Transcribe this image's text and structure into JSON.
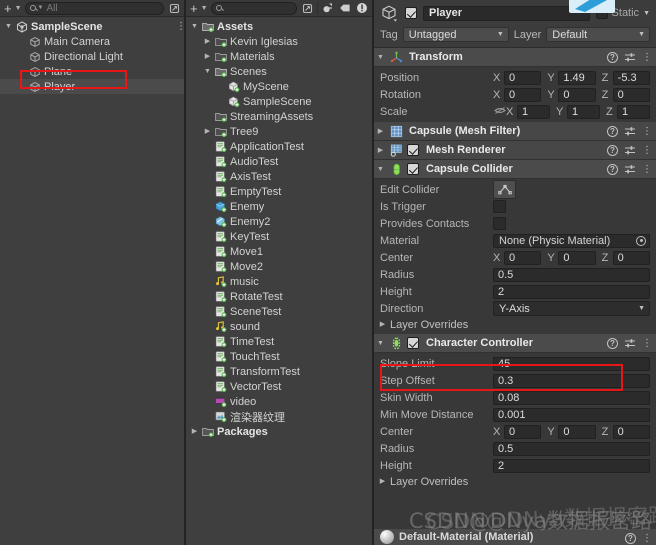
{
  "app": "Unity Editor",
  "hierarchy": {
    "toolbar": {
      "add_label": "+",
      "search_placeholder": "All"
    },
    "items": [
      {
        "label": "SampleScene",
        "indent": 0,
        "twisty": "open",
        "icon": "scene-icon",
        "bold": true,
        "selected": false,
        "kebab": true
      },
      {
        "label": "Main Camera",
        "indent": 1,
        "twisty": "empty",
        "icon": "gameobject-icon",
        "bold": false,
        "selected": false,
        "kebab": false
      },
      {
        "label": "Directional Light",
        "indent": 1,
        "twisty": "empty",
        "icon": "gameobject-icon",
        "bold": false,
        "selected": false,
        "kebab": false
      },
      {
        "label": "Plane",
        "indent": 1,
        "twisty": "empty",
        "icon": "gameobject-icon",
        "bold": false,
        "selected": false,
        "kebab": false
      },
      {
        "label": "Player",
        "indent": 1,
        "twisty": "empty",
        "icon": "gameobject-icon",
        "bold": false,
        "selected": true,
        "kebab": false
      }
    ]
  },
  "project": {
    "toolbar": {
      "add_label": "+",
      "search_placeholder": ""
    },
    "items": [
      {
        "label": "Assets",
        "indent": 0,
        "twisty": "open",
        "icon": "folder-open-icon",
        "bold": true
      },
      {
        "label": "Kevin Iglesias",
        "indent": 1,
        "twisty": "closed",
        "icon": "folder-icon",
        "bold": false
      },
      {
        "label": "Materials",
        "indent": 1,
        "twisty": "closed",
        "icon": "folder-icon",
        "bold": false
      },
      {
        "label": "Scenes",
        "indent": 1,
        "twisty": "open",
        "icon": "folder-open-icon",
        "bold": false
      },
      {
        "label": "MyScene",
        "indent": 2,
        "twisty": "empty",
        "icon": "scene-asset-icon",
        "bold": false
      },
      {
        "label": "SampleScene",
        "indent": 2,
        "twisty": "empty",
        "icon": "scene-asset-icon",
        "bold": false
      },
      {
        "label": "StreamingAssets",
        "indent": 1,
        "twisty": "empty",
        "icon": "folder-empty-icon",
        "bold": false
      },
      {
        "label": "Tree9",
        "indent": 1,
        "twisty": "closed",
        "icon": "folder-icon",
        "bold": false
      },
      {
        "label": "ApplicationTest",
        "indent": 1,
        "twisty": "empty",
        "icon": "script-icon",
        "bold": false
      },
      {
        "label": "AudioTest",
        "indent": 1,
        "twisty": "empty",
        "icon": "script-icon",
        "bold": false
      },
      {
        "label": "AxisTest",
        "indent": 1,
        "twisty": "empty",
        "icon": "script-icon",
        "bold": false
      },
      {
        "label": "EmptyTest",
        "indent": 1,
        "twisty": "empty",
        "icon": "script-icon",
        "bold": false
      },
      {
        "label": "Enemy",
        "indent": 1,
        "twisty": "empty",
        "icon": "prefab-icon",
        "bold": false
      },
      {
        "label": "Enemy2",
        "indent": 1,
        "twisty": "empty",
        "icon": "prefab-variant-icon",
        "bold": false
      },
      {
        "label": "KeyTest",
        "indent": 1,
        "twisty": "empty",
        "icon": "script-icon",
        "bold": false
      },
      {
        "label": "Move1",
        "indent": 1,
        "twisty": "empty",
        "icon": "script-icon",
        "bold": false
      },
      {
        "label": "Move2",
        "indent": 1,
        "twisty": "empty",
        "icon": "script-icon",
        "bold": false
      },
      {
        "label": "music",
        "indent": 1,
        "twisty": "empty",
        "icon": "audio-icon",
        "bold": false
      },
      {
        "label": "RotateTest",
        "indent": 1,
        "twisty": "empty",
        "icon": "script-icon",
        "bold": false
      },
      {
        "label": "SceneTest",
        "indent": 1,
        "twisty": "empty",
        "icon": "script-icon",
        "bold": false
      },
      {
        "label": "sound",
        "indent": 1,
        "twisty": "empty",
        "icon": "audio-icon",
        "bold": false
      },
      {
        "label": "TimeTest",
        "indent": 1,
        "twisty": "empty",
        "icon": "script-icon",
        "bold": false
      },
      {
        "label": "TouchTest",
        "indent": 1,
        "twisty": "empty",
        "icon": "script-icon",
        "bold": false
      },
      {
        "label": "TransformTest",
        "indent": 1,
        "twisty": "empty",
        "icon": "script-icon",
        "bold": false
      },
      {
        "label": "VectorTest",
        "indent": 1,
        "twisty": "empty",
        "icon": "script-icon",
        "bold": false
      },
      {
        "label": "video",
        "indent": 1,
        "twisty": "empty",
        "icon": "video-icon",
        "bold": false
      },
      {
        "label": "渲染器纹理",
        "indent": 1,
        "twisty": "empty",
        "icon": "render-texture-icon",
        "bold": false
      },
      {
        "label": "Packages",
        "indent": 0,
        "twisty": "closed",
        "icon": "folder-empty-icon",
        "bold": true
      }
    ]
  },
  "inspector": {
    "object_name": "Player",
    "enabled": true,
    "static_label": "Static",
    "tag_label": "Tag",
    "tag_value": "Untagged",
    "layer_label": "Layer",
    "layer_value": "Default",
    "components": [
      {
        "name": "Transform",
        "icon": "transform-icon",
        "has_checkbox": false,
        "rows": [
          {
            "label": "Position",
            "type": "vector3",
            "x": "0",
            "y": "1.49",
            "z": "-5.3"
          },
          {
            "label": "Rotation",
            "type": "vector3",
            "x": "0",
            "y": "0",
            "z": "0"
          },
          {
            "label": "Scale",
            "type": "vector3",
            "x": "1",
            "y": "1",
            "z": "1",
            "link_icon": true
          }
        ]
      },
      {
        "name": "Capsule (Mesh Filter)",
        "icon": "mesh-filter-icon",
        "has_checkbox": false,
        "collapsed": true,
        "rows": []
      },
      {
        "name": "Mesh Renderer",
        "icon": "mesh-renderer-icon",
        "has_checkbox": true,
        "checked": true,
        "collapsed": true,
        "rows": []
      },
      {
        "name": "Capsule Collider",
        "icon": "capsule-collider-icon",
        "has_checkbox": true,
        "checked": true,
        "rows": [
          {
            "label": "Edit Collider",
            "type": "button"
          },
          {
            "label": "Is Trigger",
            "type": "checkbox",
            "value": false
          },
          {
            "label": "Provides Contacts",
            "type": "checkbox",
            "value": false
          },
          {
            "label": "Material",
            "type": "object",
            "value": "None (Physic Material)"
          },
          {
            "label": "Center",
            "type": "vector3",
            "x": "0",
            "y": "0",
            "z": "0"
          },
          {
            "label": "Radius",
            "type": "text",
            "value": "0.5"
          },
          {
            "label": "Height",
            "type": "text",
            "value": "2"
          },
          {
            "label": "Direction",
            "type": "dropdown",
            "value": "Y-Axis"
          },
          {
            "label": "Layer Overrides",
            "type": "foldout"
          }
        ]
      },
      {
        "name": "Character Controller",
        "icon": "character-controller-icon",
        "has_checkbox": true,
        "checked": true,
        "highlighted": true,
        "rows": [
          {
            "label": "Slope Limit",
            "type": "text",
            "value": "45"
          },
          {
            "label": "Step Offset",
            "type": "text",
            "value": "0.3"
          },
          {
            "label": "Skin Width",
            "type": "text",
            "value": "0.08"
          },
          {
            "label": "Min Move Distance",
            "type": "text",
            "value": "0.001"
          },
          {
            "label": "Center",
            "type": "vector3",
            "x": "0",
            "y": "0",
            "z": "0"
          },
          {
            "label": "Radius",
            "type": "text",
            "value": "0.5"
          },
          {
            "label": "Height",
            "type": "text",
            "value": "2"
          },
          {
            "label": "Layer Overrides",
            "type": "foldout"
          }
        ]
      }
    ],
    "material_footer": "Default-Material (Material)"
  },
  "watermark": {
    "line1": "CSDN@DNya数据报密路",
    "line2": "CSDN@DNya数据报密路"
  },
  "colors": {
    "panel_bg": "#3f3f3f",
    "inspector_bg": "#383838",
    "component_header": "#4b4b4b",
    "field_bg": "#2b2b2b",
    "selection": "#4b4b4b",
    "annotation_red": "#e81616",
    "accent_green": "#8ee05c"
  }
}
